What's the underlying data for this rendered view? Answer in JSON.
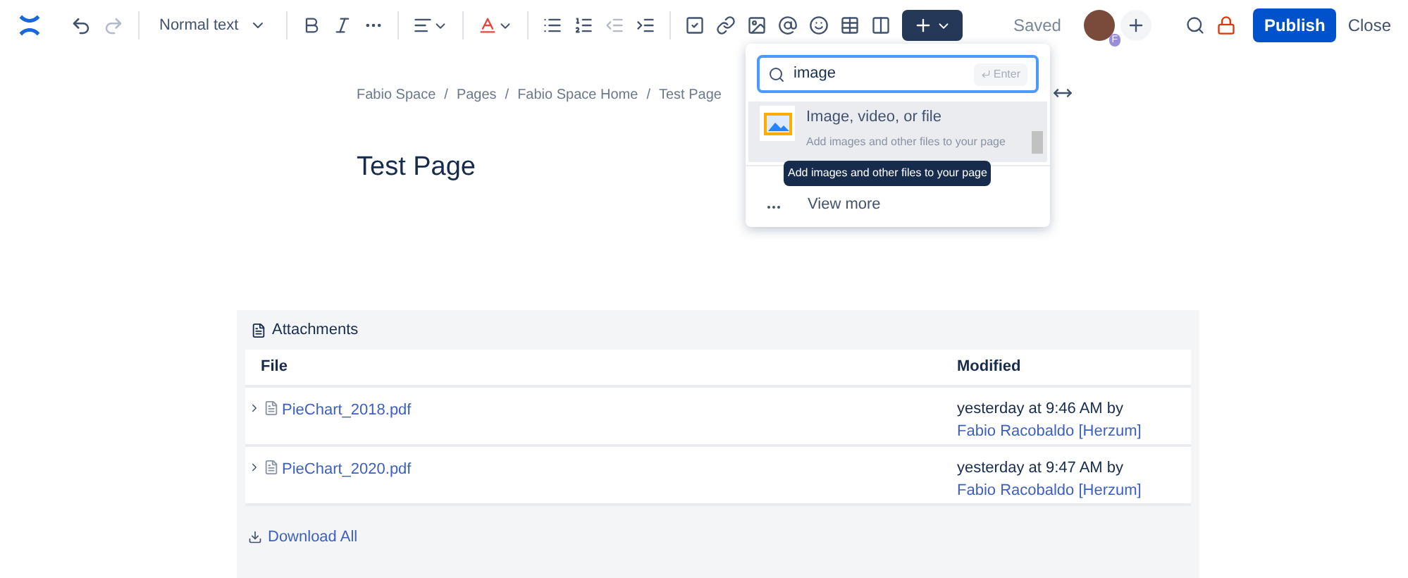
{
  "toolbar": {
    "text_style": "Normal text",
    "status": "Saved",
    "avatar_badge": "F",
    "publish": "Publish",
    "close": "Close"
  },
  "breadcrumb": {
    "separator": "/",
    "items": [
      "Fabio Space",
      "Pages",
      "Fabio Space Home",
      "Test Page"
    ]
  },
  "page_title": "Test Page",
  "insert_menu": {
    "search_value": "image",
    "enter_hint": "Enter",
    "results": [
      {
        "title": "Image, video, or file",
        "description": "Add images and other files to your page",
        "selected": true
      }
    ],
    "view_more": "View more",
    "tooltip": "Add images and other files to your page"
  },
  "attachments": {
    "title": "Attachments",
    "columns": [
      "File",
      "Modified"
    ],
    "rows": [
      {
        "file": "PieChart_2018.pdf",
        "modified": "yesterday at 9:46 AM by",
        "author": "Fabio Racobaldo [Herzum]"
      },
      {
        "file": "PieChart_2020.pdf",
        "modified": "yesterday at 9:47 AM by",
        "author": "Fabio Racobaldo [Herzum]"
      }
    ],
    "download_all": "Download All"
  }
}
